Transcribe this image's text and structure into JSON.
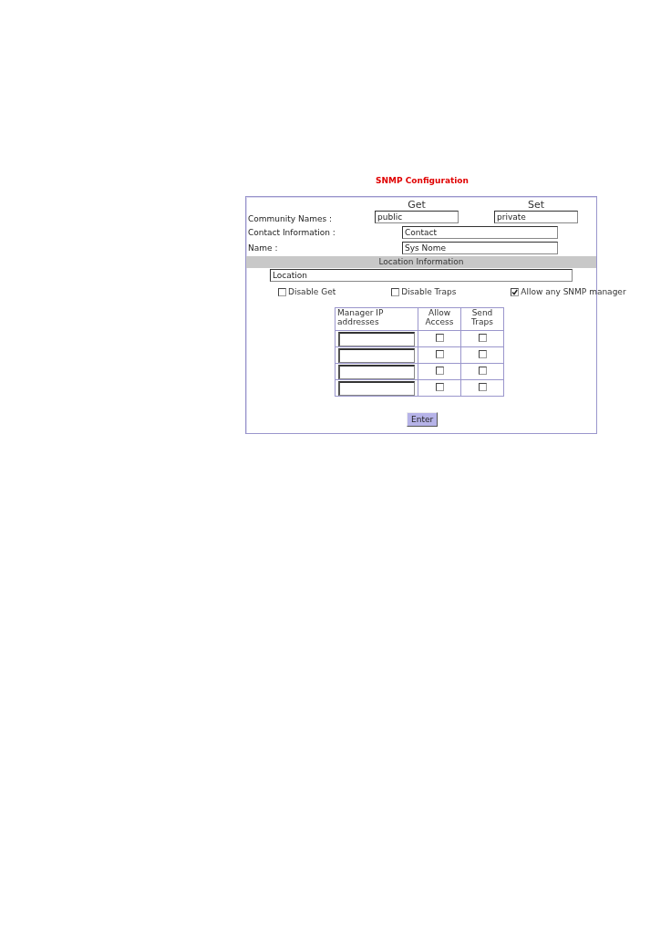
{
  "title": "SNMP Configuration",
  "community": {
    "label": "Community Names :",
    "get_heading": "Get",
    "get_value": "public",
    "set_heading": "Set",
    "set_value": "private"
  },
  "contact": {
    "label": "Contact Information :",
    "value": "Contact"
  },
  "name": {
    "label": "Name :",
    "value": "Sys Nome"
  },
  "location": {
    "heading": "Location Information",
    "value": "Location"
  },
  "options": [
    {
      "label": "Disable Get",
      "checked": false
    },
    {
      "label": "Disable Traps",
      "checked": false
    },
    {
      "label": "Allow any SNMP manager",
      "checked": true
    }
  ],
  "managers": {
    "columns": [
      "Manager IP addresses",
      "Allow Access",
      "Send Traps"
    ],
    "rows": [
      {
        "ip": "",
        "allow_access": false,
        "send_traps": false
      },
      {
        "ip": "",
        "allow_access": false,
        "send_traps": false
      },
      {
        "ip": "",
        "allow_access": false,
        "send_traps": false
      },
      {
        "ip": "",
        "allow_access": false,
        "send_traps": false
      }
    ]
  },
  "button": "Enter"
}
